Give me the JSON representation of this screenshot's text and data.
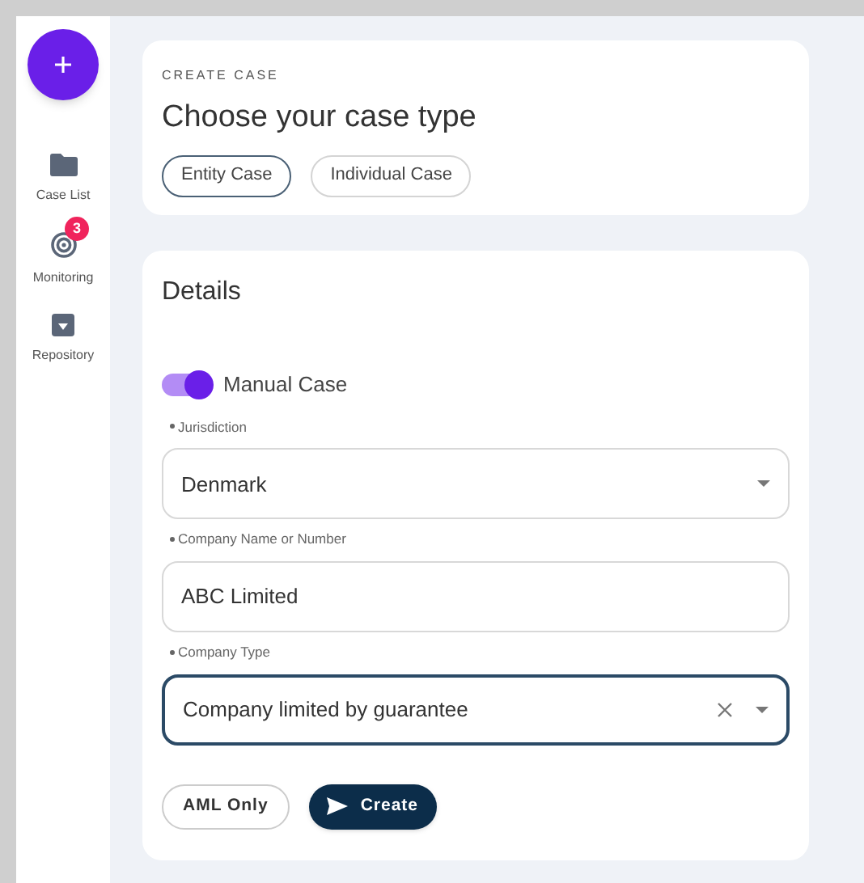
{
  "sidebar": {
    "items": [
      {
        "label": "Case List",
        "kind": "folder"
      },
      {
        "label": "Monitoring",
        "kind": "radar",
        "badge": "3"
      },
      {
        "label": "Repository",
        "kind": "archive"
      }
    ]
  },
  "header": {
    "eyebrow": "CREATE CASE",
    "title": "Choose your case type",
    "case_types": [
      {
        "label": "Entity Case",
        "selected": true
      },
      {
        "label": "Individual Case",
        "selected": false
      }
    ]
  },
  "details": {
    "title": "Details",
    "manual_case": {
      "label": "Manual Case",
      "on": true
    },
    "fields": [
      {
        "label": "Jurisdiction",
        "required": true,
        "kind": "select",
        "value": "Denmark",
        "focused": false
      },
      {
        "label": "Company Name or Number",
        "required": true,
        "kind": "input",
        "value": "ABC Limited",
        "focused": false
      },
      {
        "label": "Company Type",
        "required": true,
        "kind": "clearable-select",
        "value": "Company limited by guarantee",
        "focused": true
      }
    ],
    "buttons": [
      {
        "label": "AML Only",
        "kind": "outline"
      },
      {
        "label": "Create",
        "kind": "primary"
      }
    ]
  }
}
